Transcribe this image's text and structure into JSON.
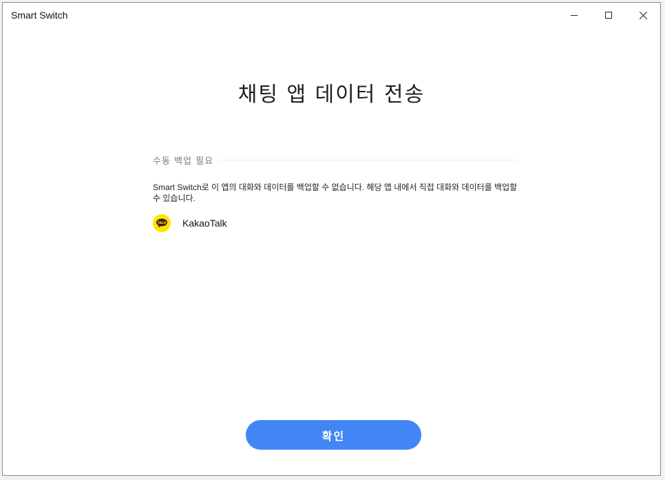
{
  "window": {
    "title": "Smart Switch"
  },
  "page": {
    "title": "채팅 앱 데이터 전송"
  },
  "section": {
    "label": "수동 백업 필요",
    "description": "Smart Switch로 이 앱의 대화와 데이터를 백업할 수 없습니다. 해당 앱 내에서 직접 대화와 데이터를 백업할 수 있습니다.",
    "apps": [
      {
        "name": "KakaoTalk",
        "icon": "kakaotalk-icon",
        "icon_color": "#FEE500"
      }
    ]
  },
  "footer": {
    "confirm_label": "확인"
  },
  "colors": {
    "accent": "#4285F4"
  }
}
